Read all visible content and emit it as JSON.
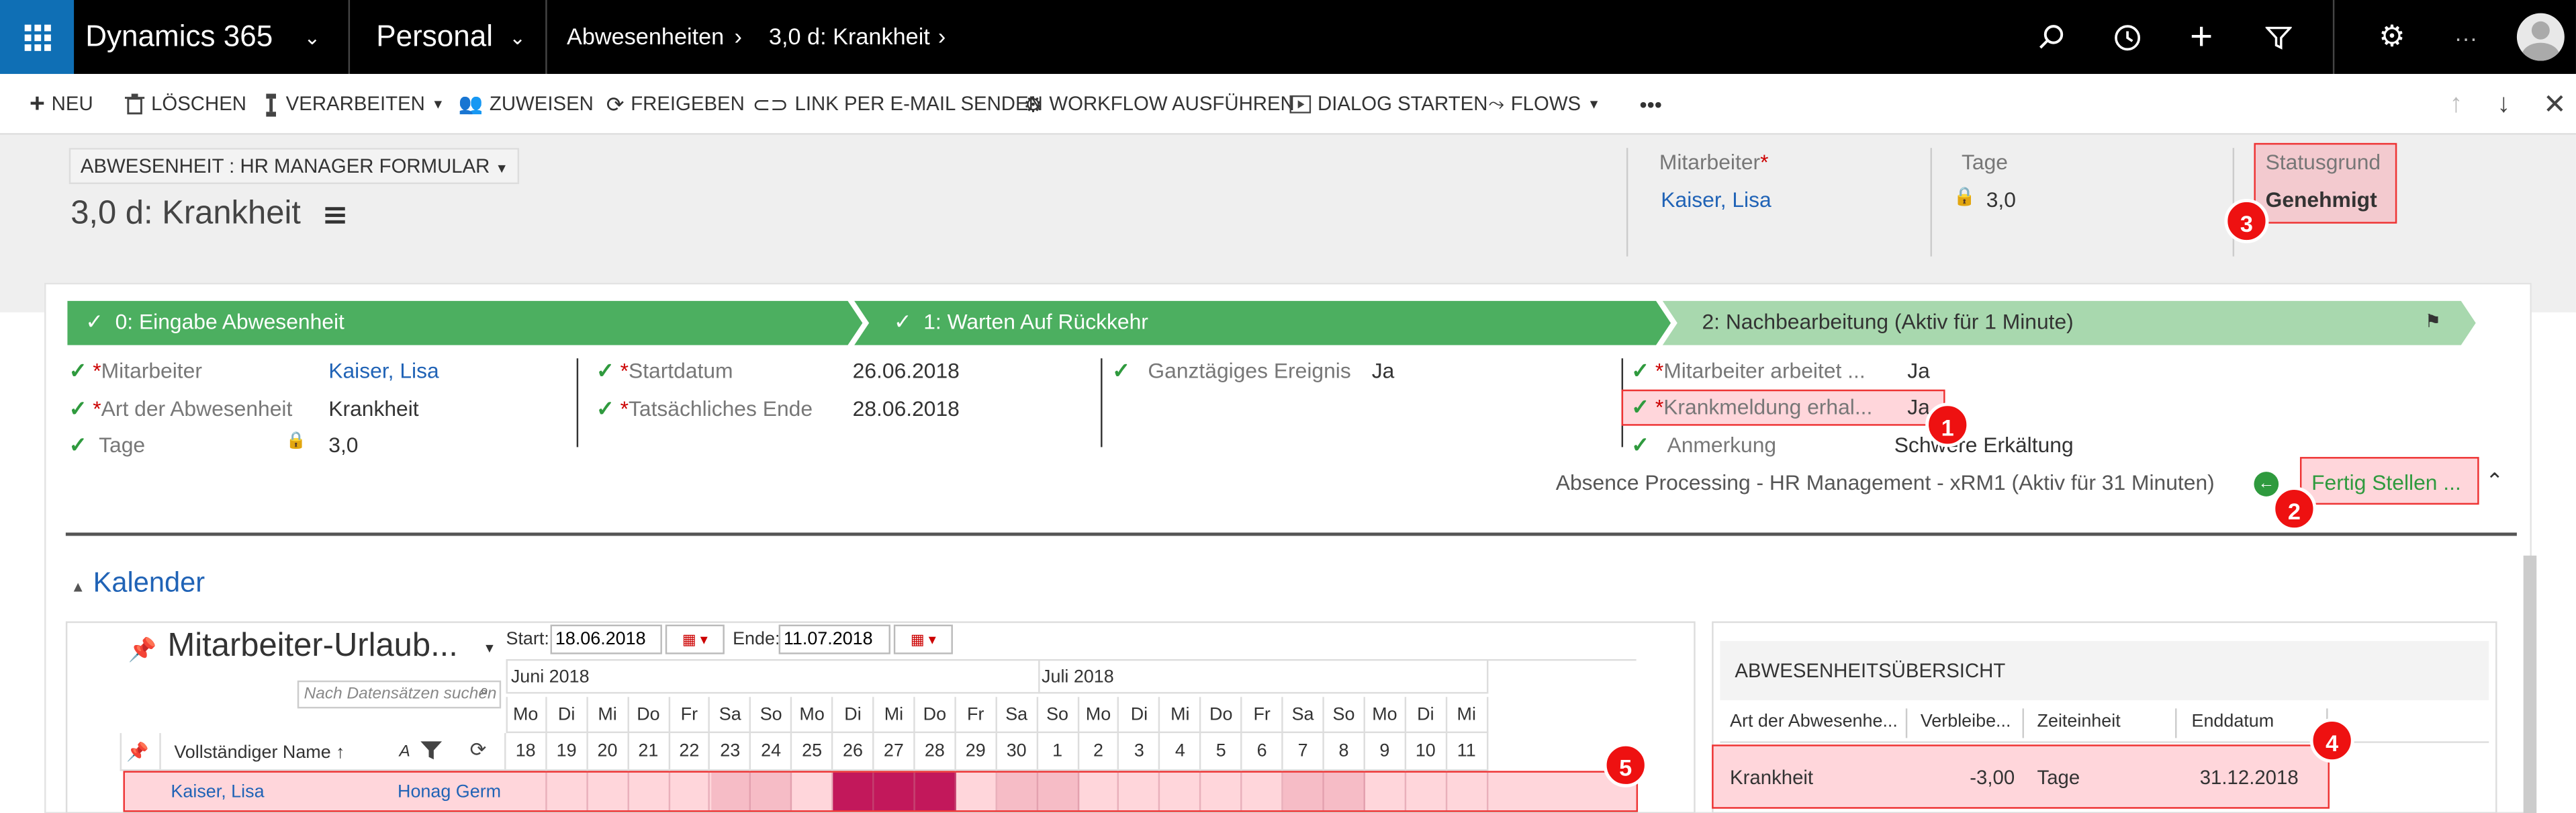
{
  "topbar": {
    "app_name": "Dynamics 365",
    "area": "Personal",
    "breadcrumb_1": "Abwesenheiten",
    "breadcrumb_2": "3,0 d: Krankheit"
  },
  "commandbar": {
    "new": "NEU",
    "delete": "LÖSCHEN",
    "process": "VERARBEITEN",
    "assign": "ZUWEISEN",
    "share": "FREIGEBEN",
    "email_link": "LINK PER E-MAIL SENDEN",
    "workflow": "WORKFLOW AUSFÜHREN",
    "dialog": "DIALOG STARTEN",
    "flows": "FLOWS",
    "more": "•••"
  },
  "header": {
    "form_selector": "ABWESENHEIT : HR MANAGER FORMULAR",
    "title": "3,0 d: Krankheit",
    "employee_label": "Mitarbeiter",
    "employee_value": "Kaiser, Lisa",
    "days_label": "Tage",
    "days_value": "3,0",
    "status_label": "Statusgrund",
    "status_value": "Genehmigt"
  },
  "bpf": {
    "stage1": "0: Eingabe Abwesenheit",
    "stage2": "1: Warten Auf Rückkehr",
    "stage3": "2: Nachbearbeitung (Aktiv für 1 Minute)",
    "col1": [
      {
        "label": "Mitarbeiter",
        "value": "Kaiser, Lisa"
      },
      {
        "label": "Art der Abwesenheit",
        "value": "Krankheit"
      },
      {
        "label": "Tage",
        "value": "3,0"
      }
    ],
    "col2": [
      {
        "label": "Startdatum",
        "value": "26.06.2018"
      },
      {
        "label": "Tatsächliches Ende",
        "value": "28.06.2018"
      }
    ],
    "col3": [
      {
        "label": "Ganztägiges Ereignis",
        "value": "Ja"
      }
    ],
    "col4": [
      {
        "label": "Mitarbeiter arbeitet ...",
        "value": "Ja"
      },
      {
        "label": "Krankmeldung erhal...",
        "value": "Ja"
      },
      {
        "label": "Anmerkung",
        "value": "Schwere Erkältung"
      }
    ],
    "process_name": "Absence Processing - HR Management - xRM1 (Aktiv für 31 Minuten)",
    "finish_button": "Fertig Stellen ..."
  },
  "calendar": {
    "section_title": "Kalender",
    "view_title": "Mitarbeiter-Urlaub...",
    "search_placeholder": "Nach Datensätzen suchen",
    "start_label": "Start:",
    "start_value": "18.06.2018",
    "end_label": "Ende:",
    "end_value": "11.07.2018",
    "month_june": "Juni 2018",
    "month_july": "Juli 2018",
    "weekdays": [
      "Mo",
      "Di",
      "Mi",
      "Do",
      "Fr",
      "Sa",
      "So",
      "Mo",
      "Di",
      "Mi",
      "Do",
      "Fr",
      "Sa",
      "So",
      "Mo",
      "Di",
      "Mi",
      "Do",
      "Fr",
      "Sa",
      "So",
      "Mo",
      "Di",
      "Mi"
    ],
    "days": [
      "18",
      "19",
      "20",
      "21",
      "22",
      "23",
      "24",
      "25",
      "26",
      "27",
      "28",
      "29",
      "30",
      "1",
      "2",
      "3",
      "4",
      "5",
      "6",
      "7",
      "8",
      "9",
      "10",
      "11"
    ],
    "col_fullname": "Vollständiger Name ↑",
    "col_a": "A",
    "row_name": "Kaiser, Lisa",
    "row_company": "Honag Germ..."
  },
  "summary": {
    "title": "ABWESENHEITSÜBERSICHT",
    "col_type": "Art der Abwesenhe...",
    "col_remaining": "Verbleibe...",
    "col_unit": "Zeiteinheit",
    "col_end": "Enddatum",
    "row": {
      "type": "Krankheit",
      "remaining": "-3,00",
      "unit": "Tage",
      "end": "31.12.2018"
    }
  },
  "annotations": [
    "1",
    "2",
    "3",
    "4",
    "5"
  ],
  "colors": {
    "stage_done": "#4caf60",
    "stage_active": "#a8d8ae",
    "absence": "#c2185b",
    "highlight": "#e33333"
  }
}
